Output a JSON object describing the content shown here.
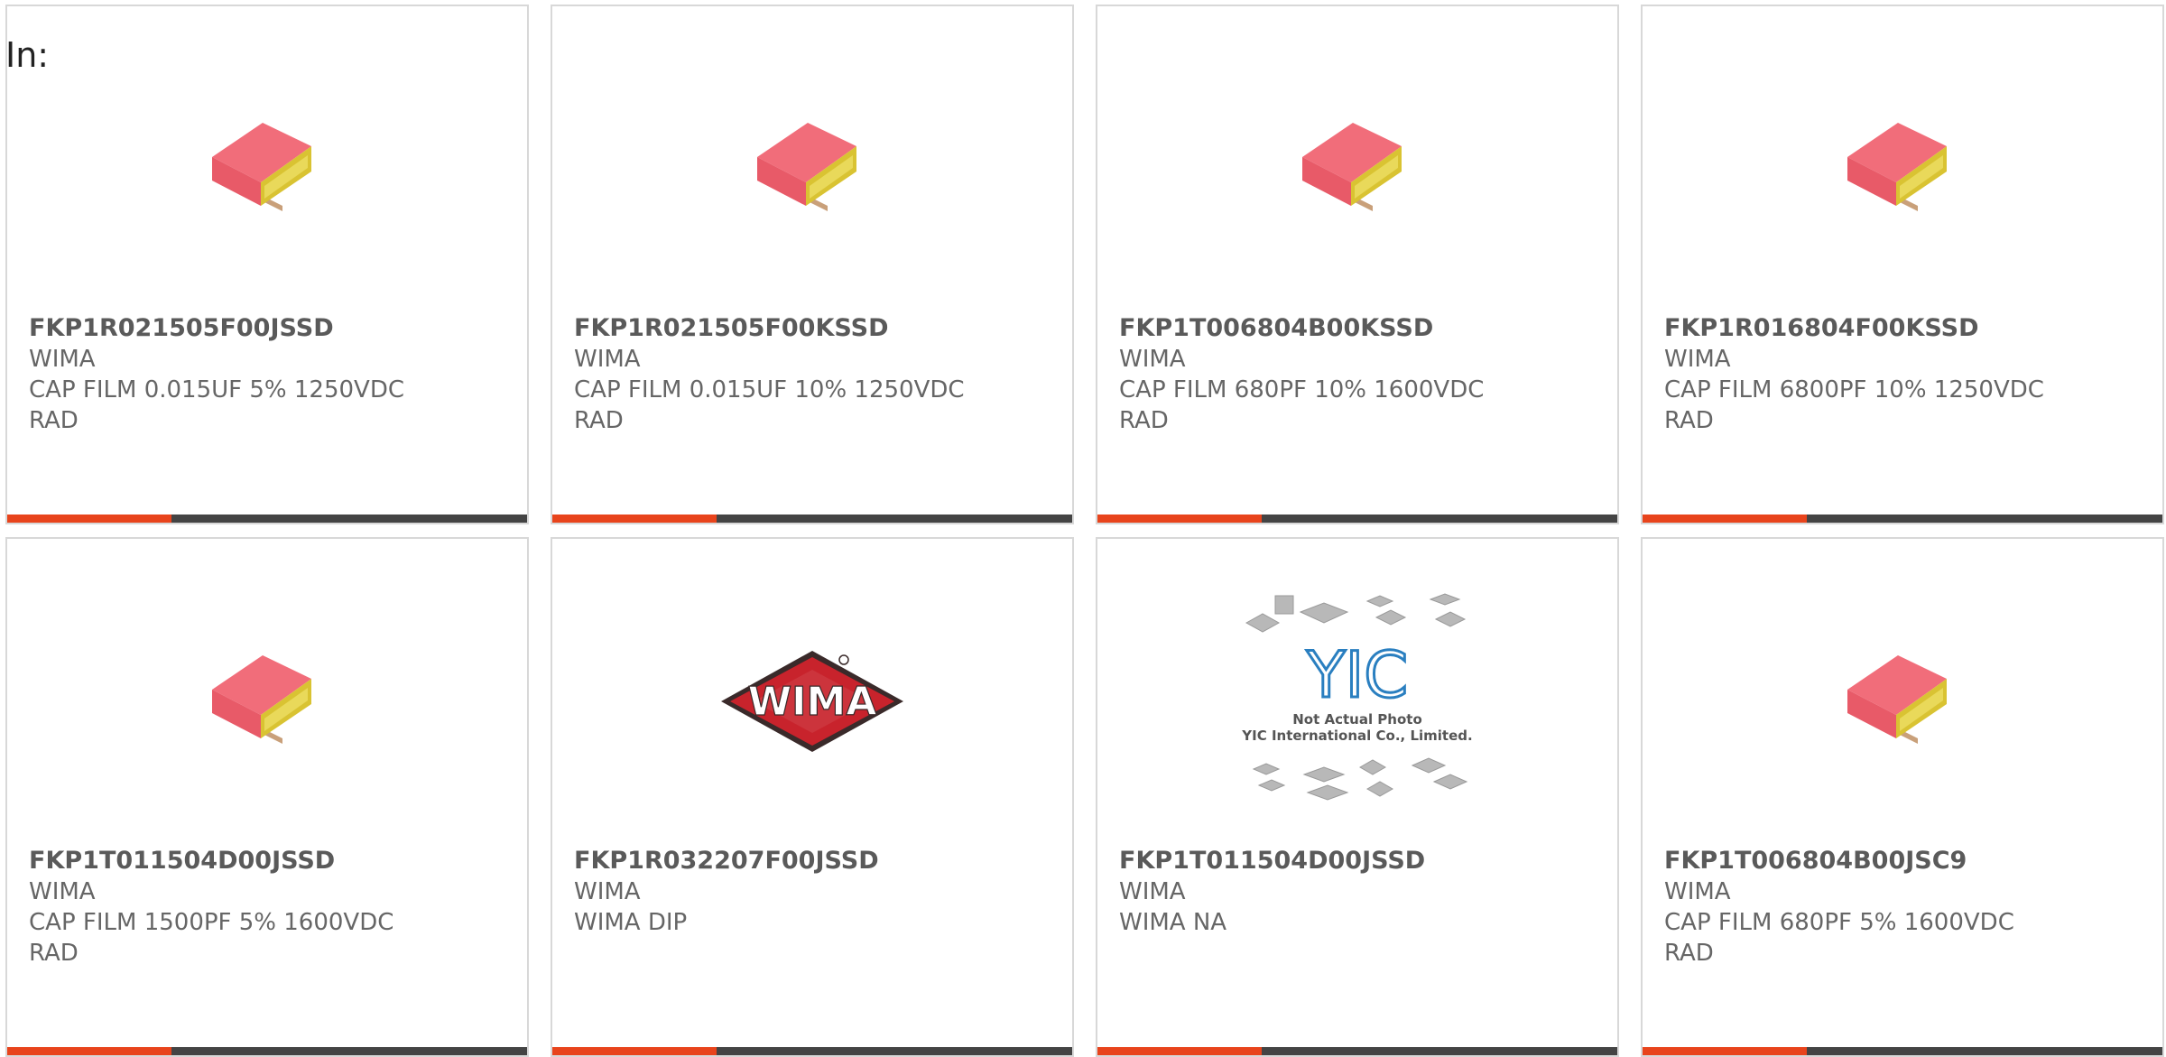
{
  "header": {
    "in_label": "In:"
  },
  "colors": {
    "accent": "#e8441c",
    "bar_dark": "#444444",
    "text_gray": "#666666",
    "card_border": "#d8d8d8"
  },
  "products": [
    {
      "part": "FKP1R021505F00JSSD",
      "brand": "WIMA",
      "desc1": "CAP FILM 0.015UF 5% 1250VDC",
      "desc2": "RAD",
      "image": "film-capacitor"
    },
    {
      "part": "FKP1R021505F00KSSD",
      "brand": "WIMA",
      "desc1": "CAP FILM 0.015UF 10% 1250VDC",
      "desc2": "RAD",
      "image": "film-capacitor"
    },
    {
      "part": "FKP1T006804B00KSSD",
      "brand": "WIMA",
      "desc1": "CAP FILM 680PF 10% 1600VDC",
      "desc2": "RAD",
      "image": "film-capacitor"
    },
    {
      "part": "FKP1R016804F00KSSD",
      "brand": "WIMA",
      "desc1": "CAP FILM 6800PF 10% 1250VDC",
      "desc2": "RAD",
      "image": "film-capacitor"
    },
    {
      "part": "FKP1T011504D00JSSD",
      "brand": "WIMA",
      "desc1": "CAP FILM 1500PF 5% 1600VDC",
      "desc2": "RAD",
      "image": "film-capacitor"
    },
    {
      "part": "FKP1R032207F00JSSD",
      "brand": "WIMA",
      "desc1": "WIMA DIP",
      "desc2": "",
      "image": "wima-logo",
      "logo_text": "WIMA"
    },
    {
      "part": "FKP1T011504D00JSSD",
      "brand": "WIMA",
      "desc1": "WIMA NA",
      "desc2": "",
      "image": "yic-placeholder",
      "logo_text": "YIC",
      "photo_note_1": "Not Actual Photo",
      "photo_note_2": "YIC International Co., Limited."
    },
    {
      "part": "FKP1T006804B00JSC9",
      "brand": "WIMA",
      "desc1": "CAP FILM 680PF 5% 1600VDC",
      "desc2": "RAD",
      "image": "film-capacitor"
    }
  ]
}
